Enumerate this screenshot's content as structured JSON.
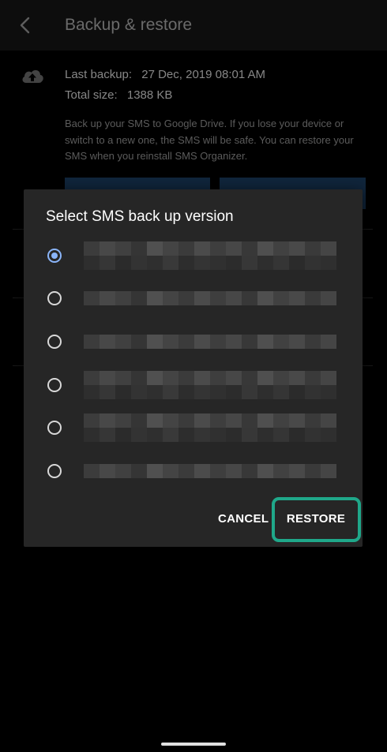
{
  "appbar": {
    "title": "Backup & restore"
  },
  "backup_info": {
    "last_backup_label": "Last backup:",
    "last_backup_value": "27 Dec, 2019 08:01 AM",
    "total_size_label": "Total size:",
    "total_size_value": "1388 KB",
    "description": "Back up your SMS to Google Drive. If you lose your device or switch to a new one, the SMS will be safe. You can restore your SMS when you reinstall SMS Organizer."
  },
  "dialog": {
    "title": "Select SMS back up version",
    "options": [
      {
        "selected": true
      },
      {
        "selected": false
      },
      {
        "selected": false
      },
      {
        "selected": false
      },
      {
        "selected": false
      },
      {
        "selected": false
      }
    ],
    "cancel_label": "CANCEL",
    "restore_label": "RESTORE"
  },
  "colors": {
    "accent": "#8ab4f8",
    "highlight": "#1fa88a",
    "dialog_bg": "#262626",
    "background": "#000000"
  },
  "icons": [
    "back-arrow-icon",
    "cloud-upload-icon",
    "radio-selected-icon",
    "radio-unselected-icon"
  ]
}
